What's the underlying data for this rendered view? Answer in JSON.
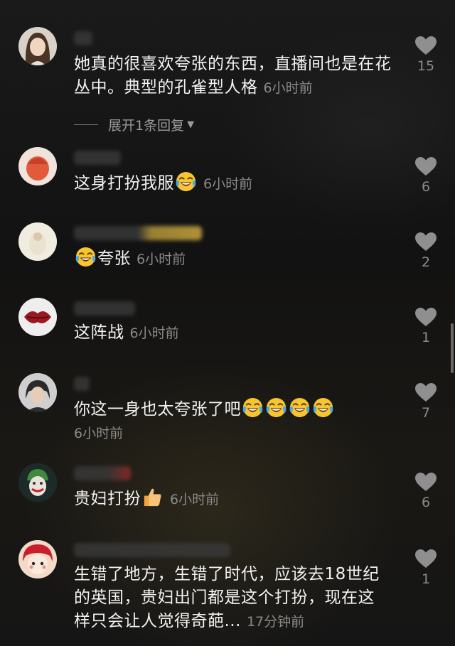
{
  "comments": [
    {
      "text": "她真的很喜欢夸张的东西，直播间也是在花丛中。典型的孔雀型人格",
      "time": "6小时前",
      "likes": "15",
      "expand": "展开1条回复"
    },
    {
      "text": "这身打扮我服",
      "time": "6小时前",
      "likes": "6"
    },
    {
      "text": "夸张",
      "time": "6小时前",
      "likes": "2"
    },
    {
      "text": "这阵战",
      "time": "6小时前",
      "likes": "1"
    },
    {
      "text": "你这一身也太夸张了吧",
      "time": "6小时前",
      "likes": "7"
    },
    {
      "text": "贵妇打扮",
      "time": "6小时前",
      "likes": "6"
    },
    {
      "text": "生错了地方，生错了时代，应该去18世纪的英国，贵妇出门都是这个打扮，现在这样只会让人觉得奇葩...",
      "time": "17分钟前",
      "likes": "1"
    }
  ],
  "icons": {
    "like": "heart-icon",
    "emoji_laugh": "laughing-crying-emoji",
    "emoji_thumb": "thumbs-up-emoji"
  },
  "colors": {
    "background": "#161616",
    "text": "#f2f2f2",
    "meta": "#8a8a8a",
    "heart": "#8f8f8f"
  }
}
